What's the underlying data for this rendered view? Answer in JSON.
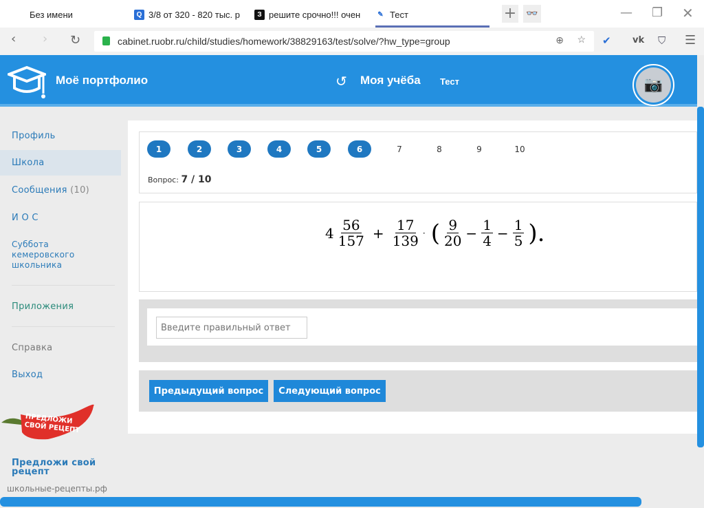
{
  "browser": {
    "tabs": [
      {
        "label": "Без имени",
        "icon": "none"
      },
      {
        "label": "3/8 от 320 - 820 тыс. р",
        "icon": "search-icon"
      },
      {
        "label": "решите срочно!!! очен",
        "icon": "znanija-icon"
      },
      {
        "label": "Тест",
        "icon": "site-icon",
        "active": true
      }
    ],
    "url": "cabinet.ruobr.ru/child/studies/homework/38829163/test/solve/?hw_type=group"
  },
  "header": {
    "brand": "Моё портфолио",
    "section": "Моя учёба",
    "subsection": "Тест",
    "accent": "#2490e0"
  },
  "sidebar": {
    "items": [
      {
        "label": "Профиль"
      },
      {
        "label": "Школа",
        "active": true
      },
      {
        "label": "Сообщения",
        "count": "(10)"
      },
      {
        "label": "И О С"
      },
      {
        "label": "Суббота кемеровского школьника"
      }
    ],
    "apps": "Приложения",
    "help": "Справка",
    "logout": "Выход",
    "promo_logo_text": "ПРЕДЛОЖИ СВОЙ РЕЦЕПТ",
    "promo_title": "Предложи свой рецепт",
    "promo_site": "школьные-рецепты.рф"
  },
  "test": {
    "questions": [
      {
        "n": "1",
        "done": true
      },
      {
        "n": "2",
        "done": true
      },
      {
        "n": "3",
        "done": true
      },
      {
        "n": "4",
        "done": true
      },
      {
        "n": "5",
        "done": true
      },
      {
        "n": "6",
        "done": true
      },
      {
        "n": "7",
        "done": false
      },
      {
        "n": "8",
        "done": false
      },
      {
        "n": "9",
        "done": false
      },
      {
        "n": "10",
        "done": false
      }
    ],
    "question_label": "Вопрос:",
    "question_value": "7 / 10",
    "formula": {
      "whole": "4",
      "f1n": "56",
      "f1d": "157",
      "plus": "+",
      "f2n": "17",
      "f2d": "139",
      "dot": "·",
      "lp": "(",
      "f3n": "9",
      "f3d": "20",
      "m1": "−",
      "f4n": "1",
      "f4d": "4",
      "m2": "−",
      "f5n": "1",
      "f5d": "5",
      "rp": ").",
      "text": "4 56/157 + 17/139 · (9/20 − 1/4 − 1/5)."
    },
    "answer_placeholder": "Введите правильный ответ",
    "answer_value": "",
    "prev": "Предыдущий вопрос",
    "next": "Следующий вопрос"
  }
}
